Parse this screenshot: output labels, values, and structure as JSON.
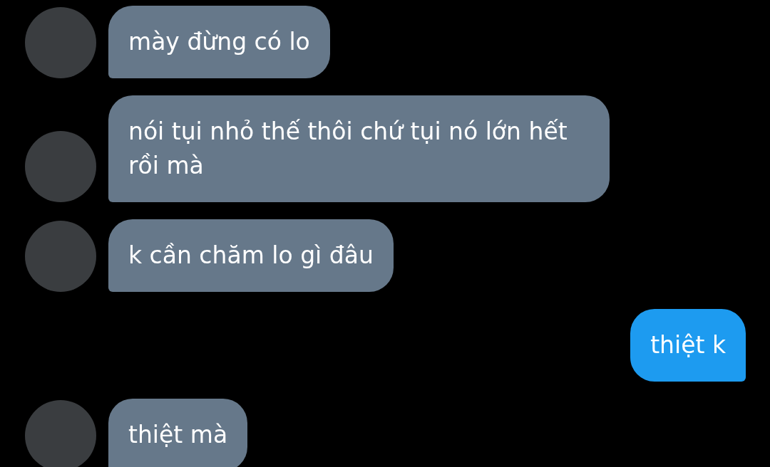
{
  "messages": [
    {
      "kind": "incoming",
      "text": "mày đừng có lo"
    },
    {
      "kind": "incoming",
      "text": "nói tụi nhỏ thế thôi chứ tụi nó lớn hết rồi mà"
    },
    {
      "kind": "incoming",
      "text": "k cần chăm lo gì đâu"
    },
    {
      "kind": "outgoing",
      "text": "thiệt k"
    },
    {
      "kind": "incoming",
      "text": "thiệt mà"
    }
  ]
}
